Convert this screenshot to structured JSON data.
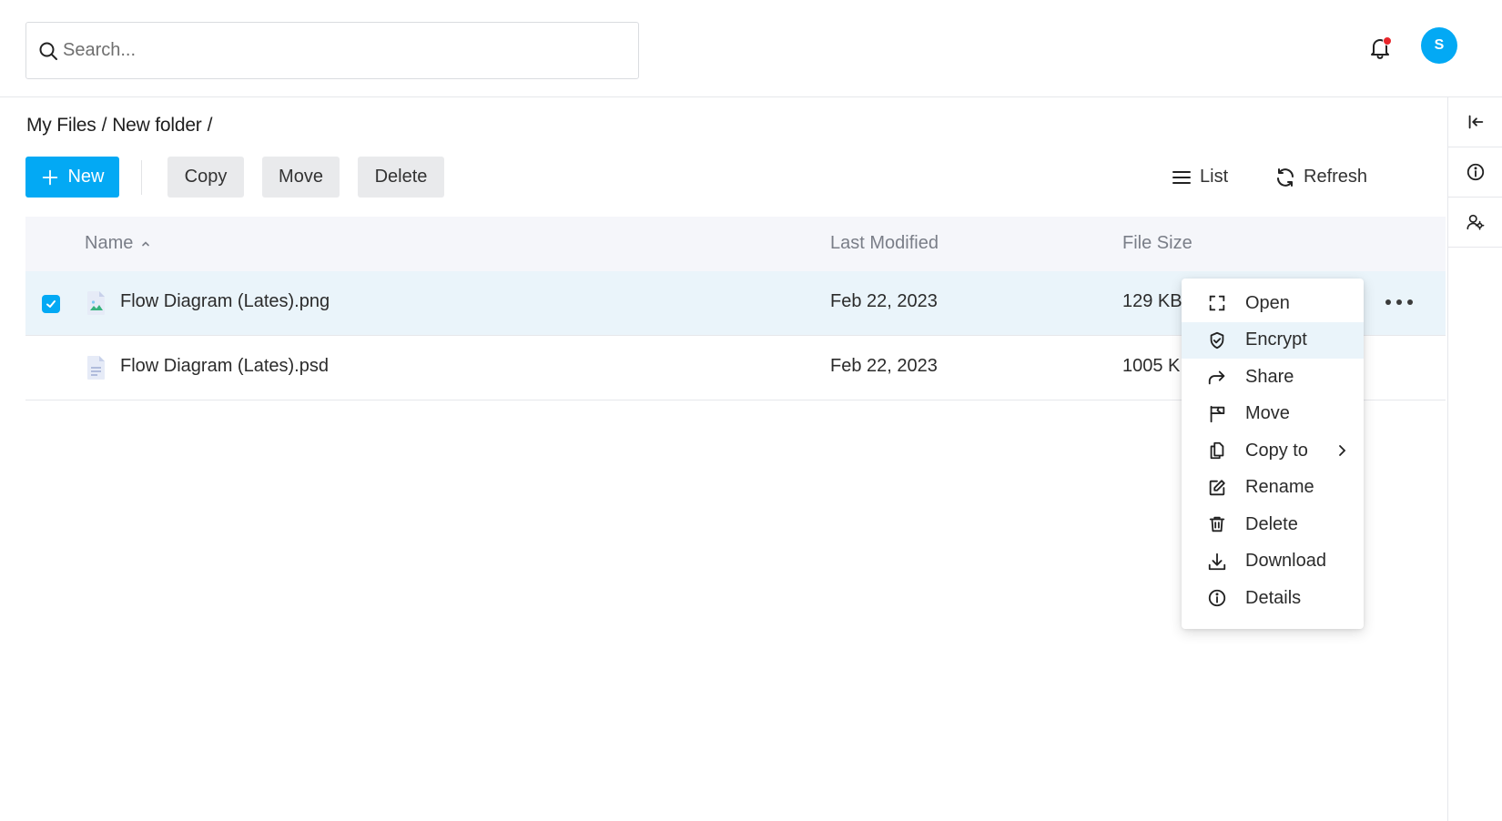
{
  "search": {
    "placeholder": "Search..."
  },
  "header": {
    "avatar_initial": "S",
    "colors": {
      "accent": "#03a9f4",
      "notification_dot": "#e8262b"
    }
  },
  "breadcrumb": [
    "My Files",
    "/",
    "New folder",
    "/"
  ],
  "toolbar": {
    "new_label": "New",
    "copy_label": "Copy",
    "move_label": "Move",
    "delete_label": "Delete",
    "view_label": "List",
    "refresh_label": "Refresh"
  },
  "table": {
    "columns": {
      "name": "Name",
      "modified": "Last Modified",
      "size": "File Size"
    },
    "rows": [
      {
        "name": "Flow Diagram (Lates).png",
        "modified": "Feb 22, 2023",
        "size": "129 KB",
        "icon": "image-file-icon",
        "selected": true
      },
      {
        "name": "Flow Diagram (Lates).psd",
        "modified": "Feb 22, 2023",
        "size": "1005 KB",
        "icon": "document-file-icon",
        "selected": false
      }
    ]
  },
  "context_menu": {
    "items": [
      {
        "label": "Open",
        "icon": "open-icon"
      },
      {
        "label": "Encrypt",
        "icon": "shield-check-icon"
      },
      {
        "label": "Share",
        "icon": "share-icon"
      },
      {
        "label": "Move",
        "icon": "flag-icon"
      },
      {
        "label": "Copy to",
        "icon": "copy-icon"
      },
      {
        "label": "Rename",
        "icon": "rename-icon"
      },
      {
        "label": "Delete",
        "icon": "trash-icon"
      },
      {
        "label": "Download",
        "icon": "download-icon"
      },
      {
        "label": "Details",
        "icon": "info-icon"
      }
    ]
  },
  "right_panel": {
    "icons": [
      "collapse-panel-icon",
      "info-icon",
      "users-icon"
    ]
  }
}
